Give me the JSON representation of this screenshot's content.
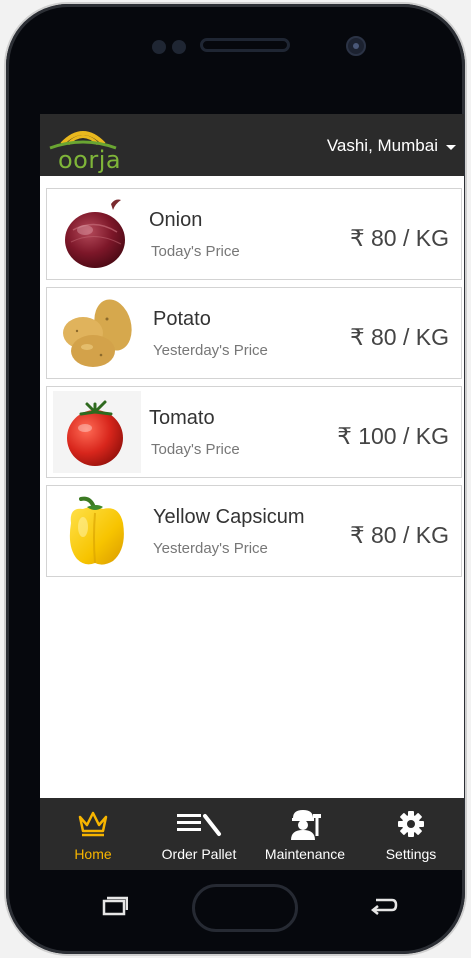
{
  "app": {
    "brand": "oorja",
    "location": "Vashi, Mumbai"
  },
  "products": [
    {
      "name": "Onion",
      "price_label": "Today's Price",
      "price": "₹ 80 / KG",
      "icon": "onion-image"
    },
    {
      "name": "Potato",
      "price_label": "Yesterday's Price",
      "price": "₹ 80 / KG",
      "icon": "potato-image"
    },
    {
      "name": "Tomato",
      "price_label": "Today's Price",
      "price": "₹ 100 / KG",
      "icon": "tomato-image"
    },
    {
      "name": "Yellow Capsicum",
      "price_label": "Yesterday's Price",
      "price": "₹ 80 / KG",
      "icon": "capsicum-image"
    }
  ],
  "nav": [
    {
      "label": "Home",
      "icon": "crown-icon",
      "active": true
    },
    {
      "label": "Order Pallet",
      "icon": "pallet-icon",
      "active": false
    },
    {
      "label": "Maintenance",
      "icon": "mechanic-icon",
      "active": false
    },
    {
      "label": "Settings",
      "icon": "gear-icon",
      "active": false
    }
  ],
  "colors": {
    "appbar": "#2b2b2b",
    "accent": "#f7b500",
    "brand_green": "#7fb539"
  }
}
